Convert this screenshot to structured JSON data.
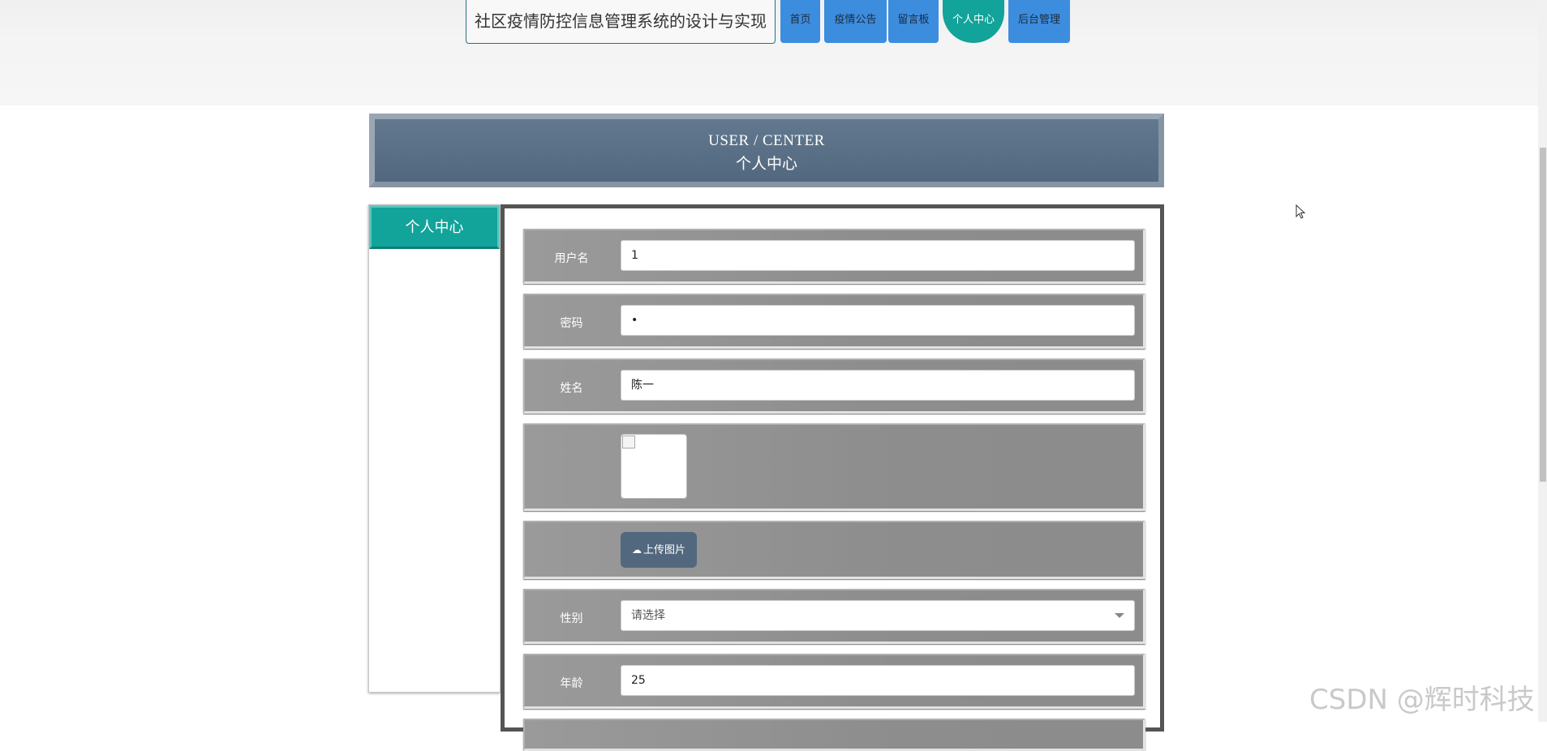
{
  "site_title": "社区疫情防控信息管理系统的设计与实现",
  "nav": {
    "home": "首页",
    "announcements": "疫情公告",
    "message_board": "留言板",
    "personal_center": "个人中心",
    "admin": "后台管理"
  },
  "banner": {
    "en": "USER / CENTER",
    "cn": "个人中心"
  },
  "sidebar": {
    "active_item": "个人中心"
  },
  "form": {
    "username": {
      "label": "用户名",
      "value": "1"
    },
    "password": {
      "label": "密码",
      "value": "•"
    },
    "name": {
      "label": "姓名",
      "value": "陈一"
    },
    "upload": {
      "label": "上传图片"
    },
    "gender": {
      "label": "性别",
      "value": "请选择"
    },
    "age": {
      "label": "年龄",
      "value": "25"
    }
  },
  "watermark": "CSDN @辉时科技",
  "colors": {
    "nav_blue": "#3d8ddf",
    "teal_active": "#12a39a",
    "banner_slate": "#5a6f85",
    "row_gray": "#939393"
  },
  "icons": [
    "cloud-upload-icon",
    "chevron-down-icon",
    "cursor-icon"
  ]
}
